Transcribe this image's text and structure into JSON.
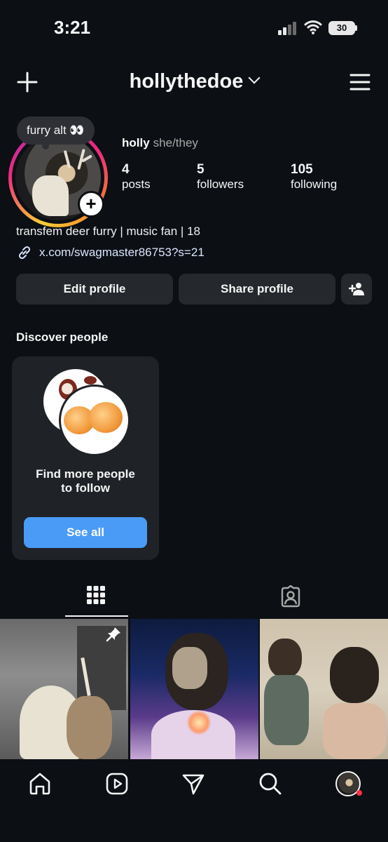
{
  "status_bar": {
    "time": "3:21",
    "battery": "30"
  },
  "header": {
    "username": "hollythedoe"
  },
  "profile": {
    "note": "furry alt 👀",
    "name": "holly",
    "pronouns": "she/they",
    "stats": [
      {
        "value": "4",
        "label": "posts"
      },
      {
        "value": "5",
        "label": "followers"
      },
      {
        "value": "105",
        "label": "following"
      }
    ],
    "bio": "transfem deer furry | music fan | 18",
    "link": "x.com/swagmaster86753?s=21"
  },
  "buttons": {
    "edit": "Edit profile",
    "share": "Share profile"
  },
  "discover": {
    "title": "Discover people",
    "card_line1": "Find more people",
    "card_line2": "to follow",
    "see_all": "See all"
  },
  "icons": {
    "create": "plus-icon",
    "menu": "hamburger-menu-icon",
    "link": "link-icon",
    "add_user": "add-user-icon",
    "grid_tab": "grid-icon",
    "tagged_tab": "tagged-person-icon",
    "pin": "pin-icon",
    "nav": [
      "home-icon",
      "reels-icon",
      "send-icon",
      "search-icon",
      "profile-avatar"
    ]
  },
  "colors": {
    "accent": "#4a9bf5",
    "background": "#0c0f14",
    "button": "#25282d",
    "notification_dot": "#ff3040"
  }
}
